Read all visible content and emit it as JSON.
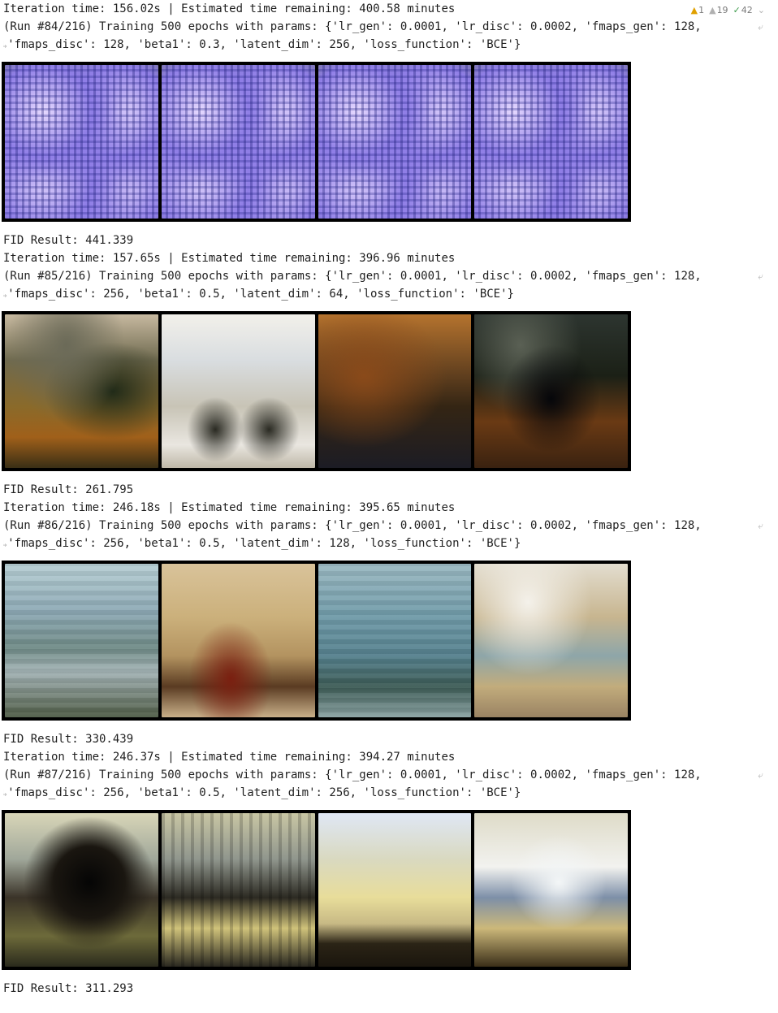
{
  "status_bar": {
    "warnings": "1",
    "weak_warnings": "19",
    "ok": "42"
  },
  "runs": [
    {
      "iteration": "Iteration time: 156.02s | Estimated time remaining: 400.58 minutes",
      "params_line1": "(Run #84/216) Training 500 epochs with params: {'lr_gen': 0.0001, 'lr_disc': 0.0002, 'fmaps_gen': 128,",
      "params_line2": "'fmaps_disc': 128, 'beta1': 0.3, 'latent_dim': 256, 'loss_function': 'BCE'}",
      "fid": "FID Result: 441.339"
    },
    {
      "iteration": "Iteration time: 157.65s | Estimated time remaining: 396.96 minutes",
      "params_line1": "(Run #85/216) Training 500 epochs with params: {'lr_gen': 0.0001, 'lr_disc': 0.0002, 'fmaps_gen': 128,",
      "params_line2": "'fmaps_disc': 256, 'beta1': 0.5, 'latent_dim': 64, 'loss_function': 'BCE'}",
      "fid": "FID Result: 261.795"
    },
    {
      "iteration": "Iteration time: 246.18s | Estimated time remaining: 395.65 minutes",
      "params_line1": "(Run #86/216) Training 500 epochs with params: {'lr_gen': 0.0001, 'lr_disc': 0.0002, 'fmaps_gen': 128,",
      "params_line2": "'fmaps_disc': 256, 'beta1': 0.5, 'latent_dim': 128, 'loss_function': 'BCE'}",
      "fid": "FID Result: 330.439"
    },
    {
      "iteration": "Iteration time: 246.37s | Estimated time remaining: 394.27 minutes",
      "params_line1": "(Run #87/216) Training 500 epochs with params: {'lr_gen': 0.0001, 'lr_disc': 0.0002, 'fmaps_gen': 128,",
      "params_line2": "'fmaps_disc': 256, 'beta1': 0.5, 'latent_dim': 256, 'loss_function': 'BCE'}",
      "fid": "FID Result: 311.293"
    }
  ],
  "wrap_glyph_end": "⤶",
  "wrap_glyph_start": "↳",
  "icons": {
    "warning": "warning-triangle-icon",
    "weak_warning": "weak-warning-triangle-icon",
    "ok": "check-icon",
    "more": "chevron-icon"
  }
}
